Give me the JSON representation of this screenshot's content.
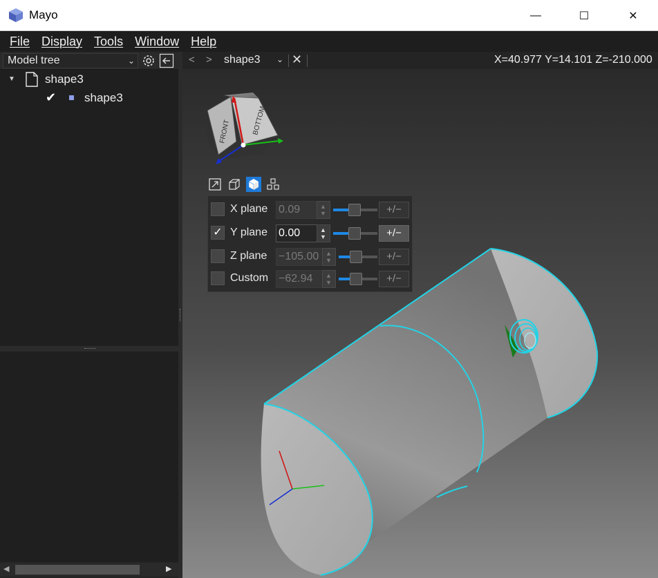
{
  "window": {
    "title": "Mayo",
    "minimize_glyph": "—",
    "maximize_glyph": "☐",
    "close_glyph": "✕"
  },
  "menubar": {
    "items": [
      "File",
      "Display",
      "Tools",
      "Window",
      "Help"
    ]
  },
  "left_panel": {
    "tree_selector": "Model tree",
    "tree": [
      {
        "label": "shape3",
        "icon": "document-icon",
        "expanded": true
      },
      {
        "label": "shape3",
        "icon": "shape-icon",
        "checked": true
      }
    ]
  },
  "viewer": {
    "back_glyph": "<",
    "forward_glyph": ">",
    "document": "shape3",
    "close_glyph": "✕",
    "coordinates": "X=40.977 Y=14.101 Z=-210.000",
    "view_cube": {
      "face_front": "FRONT",
      "face_bottom": "BOTTOM"
    },
    "clip_planes": [
      {
        "label": "X plane",
        "checked": false,
        "value": "0.09",
        "button": "+/−",
        "slider": 0.5
      },
      {
        "label": "Y plane",
        "checked": true,
        "value": "0.00",
        "button": "+/−",
        "slider": 0.5
      },
      {
        "label": "Z plane",
        "checked": false,
        "value": "−105.00",
        "button": "+/−",
        "slider": 0.5
      },
      {
        "label": "Custom",
        "checked": false,
        "value": "−62.94",
        "button": "+/−",
        "slider": 0.5
      }
    ]
  },
  "colors": {
    "accent": "#1e88e5",
    "edge": "#22d3e6",
    "axis_x": "#d01818",
    "axis_y": "#18c018",
    "axis_z": "#1830d0"
  }
}
